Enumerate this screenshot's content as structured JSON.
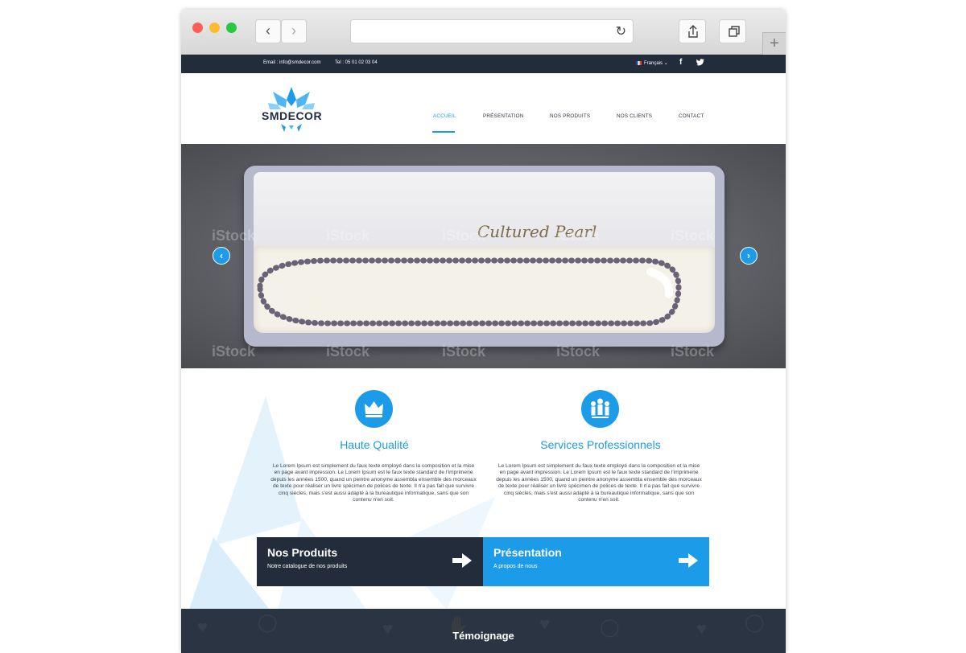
{
  "topbar": {
    "email": "Email : info@smdecor.com",
    "tel": "Tel : 05 01 02 03 04",
    "language": "Français",
    "social": [
      "facebook-icon",
      "twitter-icon"
    ]
  },
  "header": {
    "logo_text": "SMDECOR",
    "menu": [
      {
        "label": "ACCUEIL",
        "active": true
      },
      {
        "label": "PRÉSENTATION",
        "active": false
      },
      {
        "label": "NOS PRODUITS",
        "active": false
      },
      {
        "label": "NOS CLIENTS",
        "active": false
      },
      {
        "label": "CONTACT",
        "active": false
      }
    ]
  },
  "hero": {
    "box_text": "Cultured Pearl",
    "watermark": "iStock"
  },
  "features": [
    {
      "icon": "crown-icon",
      "title": "Haute Qualité",
      "text": "Le Lorem Ipsum est simplement du faux texte employé dans la composition et la mise en page avant impression. Le Lorem Ipsum est le faux texte standard de l'imprimerie depuis les années 1500, quand un peintre anonyme assembla ensemble des morceaux de texte pour réaliser un livre spécimen de polices de texte. Il n'a pas fait que survivre cinq siècles, mais s'est aussi adapté à la bureautique informatique, sans que son contenu n'en soit."
    },
    {
      "icon": "team-icon",
      "title": "Services Professionnels",
      "text": "Le Lorem Ipsum est simplement du faux texte employé dans la composition et la mise en page avant impression. Le Lorem Ipsum est le faux texte standard de l'imprimerie depuis les années 1500, quand un peintre anonyme assembla ensemble des morceaux de texte pour réaliser un livre spécimen de polices de texte. Il n'a pas fait que survivre cinq siècles, mais s'est aussi adapté à la bureautique informatique, sans que son contenu n'en soit."
    }
  ],
  "cta": [
    {
      "title": "Nos Produits",
      "subtitle": "Notre catalogue de nos produits",
      "icon": "arrow-right-icon"
    },
    {
      "title": "Présentation",
      "subtitle": "A propos de nous",
      "icon": "arrow-right-icon"
    }
  ],
  "testimonials": {
    "title": "Témoignage"
  },
  "colors": {
    "accent": "#1c9ce8",
    "dark": "#232c3a"
  }
}
